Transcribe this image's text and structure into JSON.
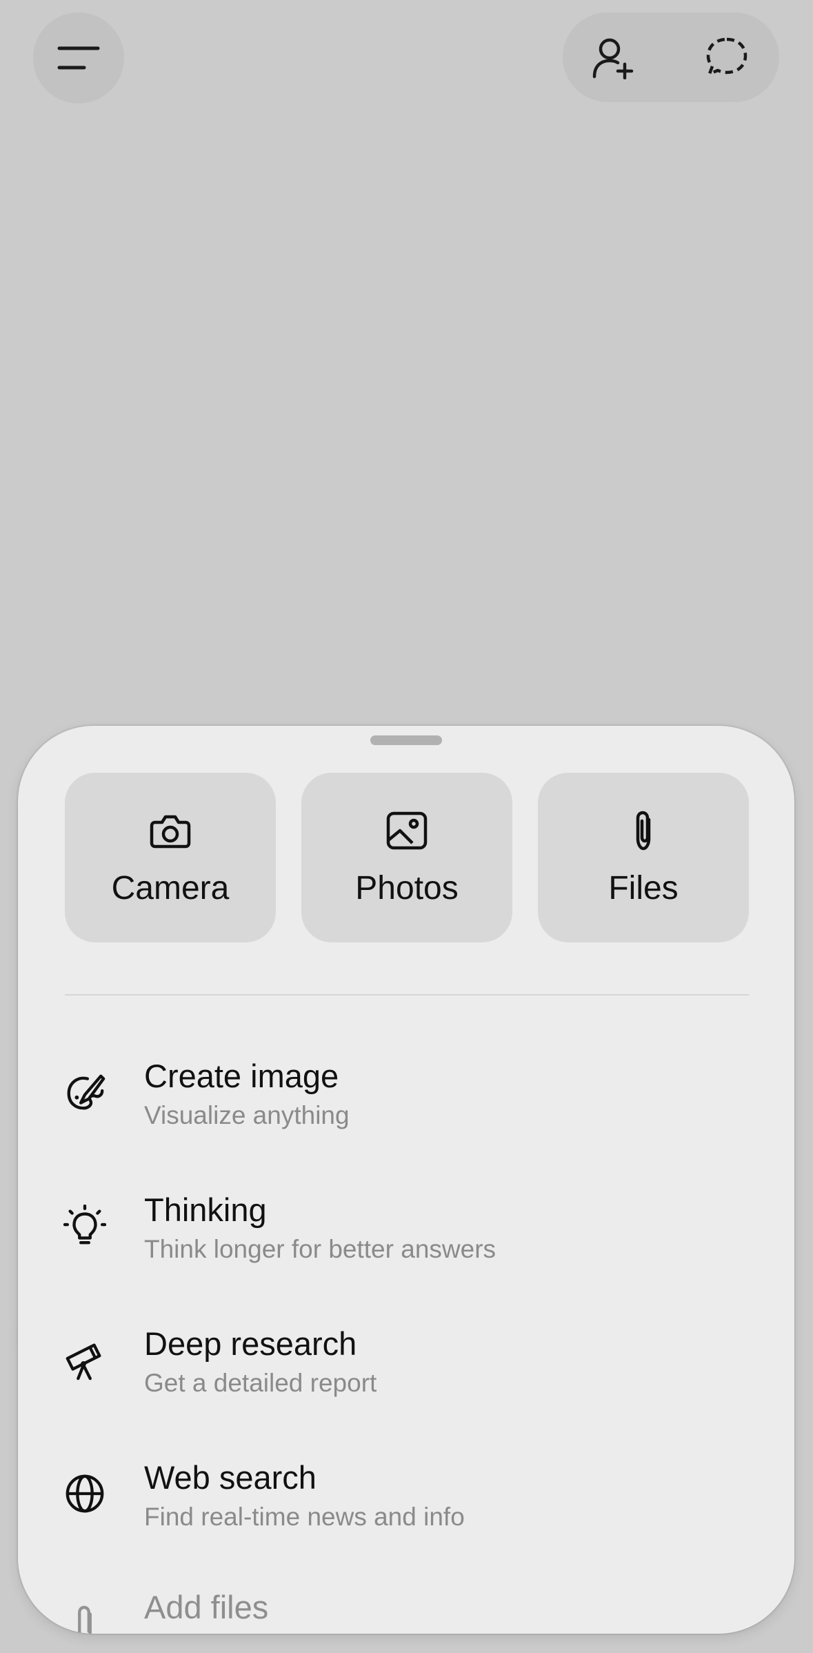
{
  "sheet": {
    "tiles": [
      {
        "label": "Camera",
        "icon": "camera-icon"
      },
      {
        "label": "Photos",
        "icon": "photos-icon"
      },
      {
        "label": "Files",
        "icon": "paperclip-icon"
      }
    ],
    "items": [
      {
        "title": "Create image",
        "subtitle": "Visualize anything",
        "icon": "paint-brush-icon"
      },
      {
        "title": "Thinking",
        "subtitle": "Think longer for better answers",
        "icon": "lightbulb-icon"
      },
      {
        "title": "Deep research",
        "subtitle": "Get a detailed report",
        "icon": "telescope-icon"
      },
      {
        "title": "Web search",
        "subtitle": "Find real-time news and info",
        "icon": "globe-icon"
      },
      {
        "title": "Add files",
        "icon": "paperclip-icon"
      }
    ]
  },
  "colors": {
    "background": "#cbcbcb",
    "sheet": "#ececec",
    "tile": "#d8d8d8",
    "subtitle": "#8a8a8a"
  }
}
